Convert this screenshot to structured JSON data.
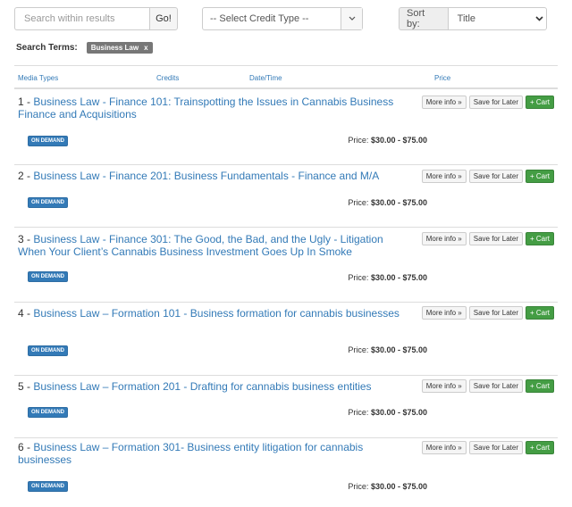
{
  "search": {
    "placeholder": "Search within results",
    "go_label": "Go!"
  },
  "credit_filter": {
    "selected": "-- Select Credit Type --"
  },
  "sort": {
    "label": "Sort by:",
    "selected": "Title"
  },
  "terms": {
    "label": "Search Terms:",
    "tag": "Business Law",
    "remove": "x"
  },
  "columns": {
    "media": "Media Types",
    "credits": "Credits",
    "datetime": "Date/Time",
    "price": "Price"
  },
  "buttons": {
    "more_info": "More info »",
    "save": "Save for Later",
    "cart": "+ Cart"
  },
  "colors": {
    "link": "#337ab7",
    "badge": "#337ab7",
    "cart": "#449d44",
    "tag": "#777777"
  },
  "results": [
    {
      "num": "1 - ",
      "title": "Business Law - Finance 101: Trainspotting the Issues in Cannabis Business Finance and Acquisitions",
      "badge": "ON DEMAND",
      "price_label": "Price: ",
      "price": "$30.00 - $75.00"
    },
    {
      "num": "2 - ",
      "title": "Business Law - Finance 201: Business Fundamentals - Finance and M/A",
      "badge": "ON DEMAND",
      "price_label": "Price: ",
      "price": "$30.00 - $75.00"
    },
    {
      "num": "3 - ",
      "title": "Business Law - Finance 301: The Good, the Bad, and the Ugly - Litigation When Your Client’s Cannabis Business Investment Goes Up In Smoke",
      "badge": "ON DEMAND",
      "price_label": "Price: ",
      "price": "$30.00 - $75.00"
    },
    {
      "num": "4 - ",
      "title": "Business Law – Formation 101 - Business formation for cannabis businesses",
      "badge": "ON DEMAND",
      "price_label": "Price: ",
      "price": "$30.00 - $75.00"
    },
    {
      "num": "5 - ",
      "title": "Business Law – Formation 201 - Drafting for cannabis business entities",
      "badge": "ON DEMAND",
      "price_label": "Price: ",
      "price": "$30.00 - $75.00"
    },
    {
      "num": "6 - ",
      "title": "Business Law – Formation 301- Business entity litigation for cannabis businesses",
      "badge": "ON DEMAND",
      "price_label": "Price: ",
      "price": "$30.00 - $75.00"
    }
  ]
}
